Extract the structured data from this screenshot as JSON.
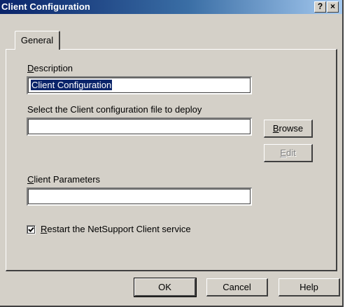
{
  "window": {
    "title": "Client Configuration",
    "help_button": "?",
    "close_button": "×"
  },
  "tabs": [
    {
      "label": "General",
      "selected": true
    }
  ],
  "description": {
    "label_first": "D",
    "label_rest": "escription",
    "value": "Client Configuration"
  },
  "config_file": {
    "label": "Select the Client configuration file to deploy",
    "value": ""
  },
  "browse_button": {
    "first": "B",
    "rest": "rowse"
  },
  "edit_button": {
    "first": "E",
    "rest": "dit",
    "enabled": false
  },
  "client_parameters": {
    "label_first": "C",
    "label_rest": "lient Parameters",
    "value": ""
  },
  "restart_checkbox": {
    "checked": true,
    "label_first": "R",
    "label_rest": "estart the NetSupport Client service"
  },
  "footer": {
    "ok_label": "OK",
    "cancel_label": "Cancel",
    "help_label": "Help"
  },
  "colors": {
    "titlebar_start": "#0a246a",
    "titlebar_end": "#a6caf0",
    "face": "#d4d0c8",
    "selection": "#0a246a"
  }
}
